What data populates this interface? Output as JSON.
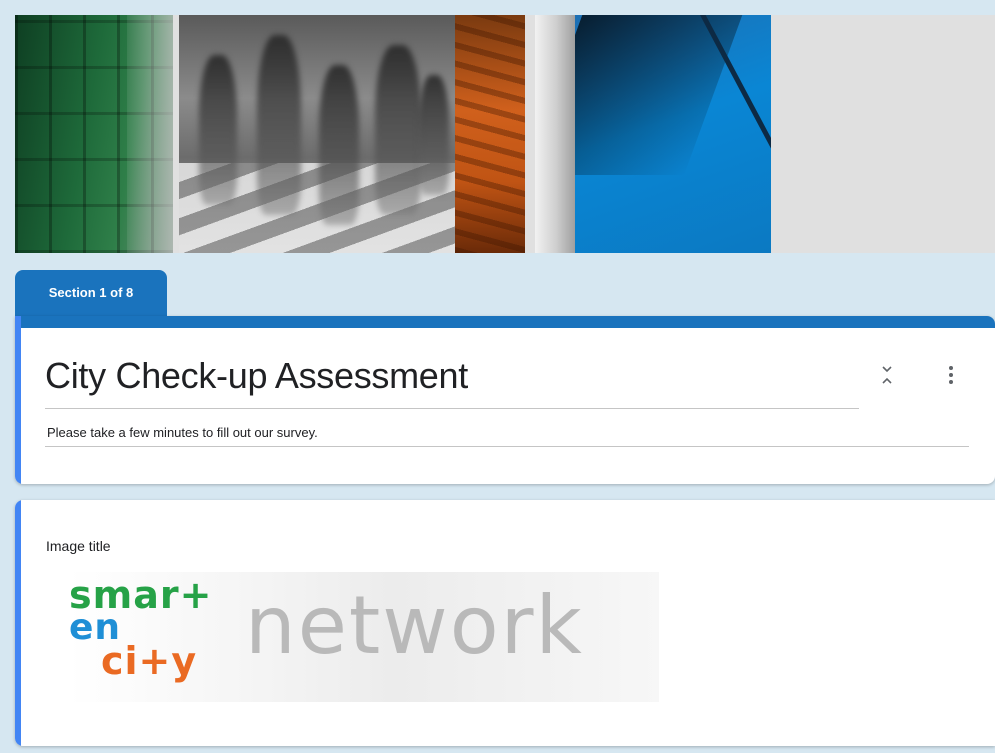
{
  "section": {
    "tab_label": "Section 1 of 8"
  },
  "form": {
    "title": "City Check-up Assessment",
    "description": "Please take a few minutes to fill out our survey."
  },
  "image_item": {
    "title": "Image title",
    "logo": {
      "line1": "smar+",
      "line2": "en",
      "line3": "ci+y",
      "word": "network",
      "colors": {
        "smart": "#26a247",
        "en": "#1f8fd6",
        "city": "#ea6a23",
        "network": "#b9b9b9"
      }
    }
  },
  "icons": {
    "collapse": "collapse-icon",
    "more": "more-vert-icon"
  },
  "theme": {
    "accent": "#1a73bd",
    "card_left_border": "#4285f4",
    "background": "#d6e7f1"
  }
}
